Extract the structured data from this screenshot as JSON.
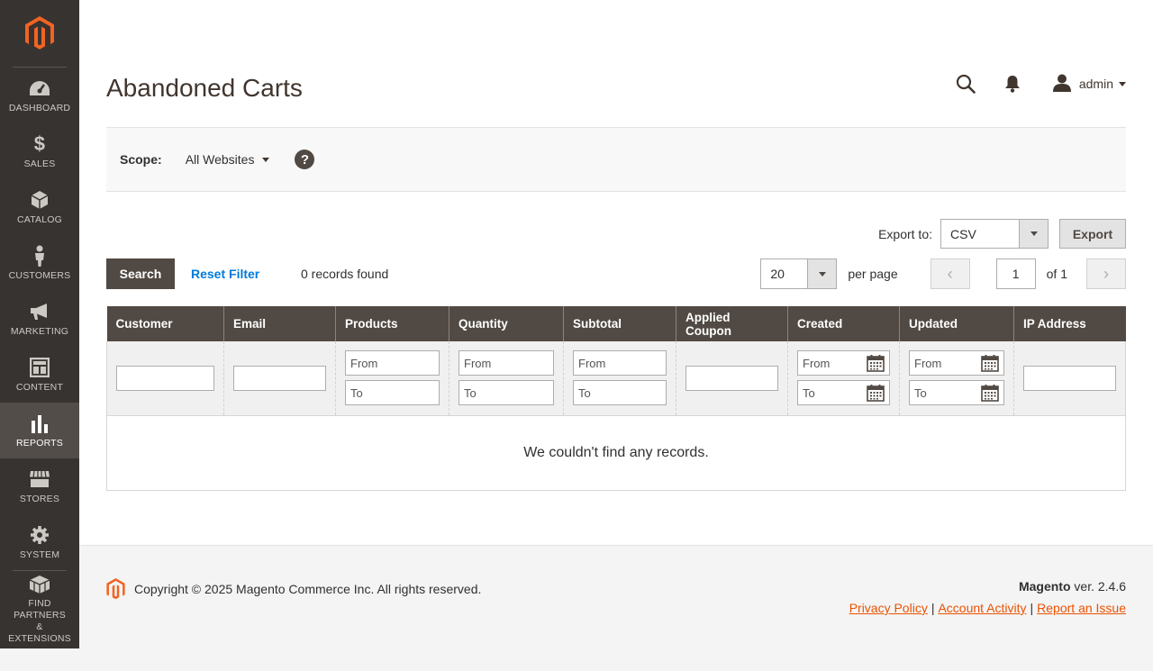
{
  "sidebar": {
    "logo": "magento-logo",
    "items": [
      {
        "label": "DASHBOARD",
        "icon": "dashboard-icon"
      },
      {
        "label": "SALES",
        "icon": "dollar-icon"
      },
      {
        "label": "CATALOG",
        "icon": "cube-icon"
      },
      {
        "label": "CUSTOMERS",
        "icon": "person-icon"
      },
      {
        "label": "MARKETING",
        "icon": "megaphone-icon"
      },
      {
        "label": "CONTENT",
        "icon": "layout-icon"
      },
      {
        "label": "REPORTS",
        "icon": "bar-chart-icon",
        "active": true
      },
      {
        "label": "STORES",
        "icon": "store-icon"
      },
      {
        "label": "SYSTEM",
        "icon": "gear-icon"
      }
    ],
    "partners": {
      "line1": "FIND PARTNERS",
      "line2": "& EXTENSIONS",
      "icon": "blocks-icon"
    }
  },
  "header": {
    "title": "Abandoned Carts",
    "user": "admin"
  },
  "scope": {
    "label": "Scope:",
    "value": "All Websites",
    "help": "?"
  },
  "export": {
    "label": "Export to:",
    "format": "CSV",
    "button": "Export"
  },
  "grid_actions": {
    "search": "Search",
    "reset": "Reset Filter",
    "records": "0 records found",
    "per_page_value": "20",
    "per_page_label": "per page",
    "page": "1",
    "of": "of 1"
  },
  "table": {
    "columns": [
      "Customer",
      "Email",
      "Products",
      "Quantity",
      "Subtotal",
      "Applied Coupon",
      "Created",
      "Updated",
      "IP Address"
    ],
    "from_placeholder": "From",
    "to_placeholder": "To",
    "empty_message": "We couldn't find any records."
  },
  "footer": {
    "copyright": "Copyright © 2025 Magento Commerce Inc. All rights reserved.",
    "brand": "Magento",
    "version": " ver. 2.4.6",
    "privacy": "Privacy Policy",
    "account_activity": " Account Activity",
    "report_issue": "Report an Issue",
    "separator": "|"
  },
  "colors": {
    "sidebar_bg": "#373330",
    "header_bg": "#514943",
    "brand_orange": "#eb5202",
    "link_blue": "#007bdb"
  }
}
